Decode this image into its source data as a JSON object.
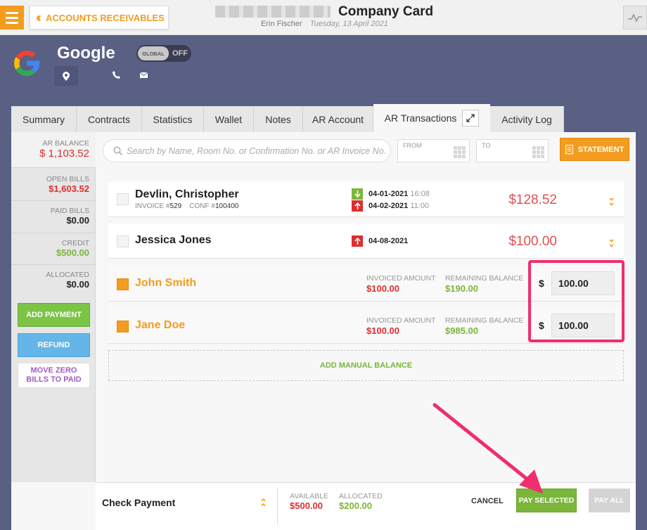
{
  "topbar": {
    "back_label": "ACCOUNTS RECEIVABLES",
    "title": "Company Card",
    "user": "Erin Fischer",
    "date": "Tuesday, 13 April 2021"
  },
  "company": {
    "name": "Google",
    "toggle_knob": "GLOBAL",
    "toggle_state": "OFF"
  },
  "tabs": [
    "Summary",
    "Contracts",
    "Statistics",
    "Wallet",
    "Notes",
    "AR Account",
    "AR Transactions",
    "Activity Log"
  ],
  "sidebar": {
    "ar_balance_label": "AR BALANCE",
    "ar_balance_value": "$ 1,103.52",
    "open_bills_label": "OPEN BILLS",
    "open_bills_value": "$1,603.52",
    "paid_bills_label": "PAID BILLS",
    "paid_bills_value": "$0.00",
    "credit_label": "CREDIT",
    "credit_value": "$500.00",
    "allocated_label": "ALLOCATED",
    "allocated_value": "$0.00",
    "add_payment": "ADD PAYMENT",
    "refund": "REFUND",
    "move_zero_line1": "MOVE ZERO",
    "move_zero_line2": "BILLS TO PAID"
  },
  "search": {
    "placeholder": "Search by Name, Room No. or Confirmation No. or AR Invoice No."
  },
  "date_filter": {
    "from": "FROM",
    "to": "TO"
  },
  "statement_label": "STATEMENT",
  "rows": [
    {
      "name": "Devlin, Christopher",
      "invoice_label": "INVOICE #",
      "invoice": "529",
      "conf_label": "CONF #",
      "conf": "100400",
      "arrival": "04-01-2021",
      "arrival_time": "16:08",
      "departure": "04-02-2021",
      "departure_time": "11:00",
      "amount": "$128.52"
    },
    {
      "name": "Jessica Jones",
      "departure": "04-08-2021",
      "amount": "$100.00"
    },
    {
      "name": "John Smith",
      "invoiced_label": "INVOICED AMOUNT",
      "invoiced": "$100.00",
      "remaining_label": "REMAINING BALANCE",
      "remaining": "$190.00",
      "currency": "$",
      "pay_value": "100.00"
    },
    {
      "name": "Jane Doe",
      "invoiced_label": "INVOICED AMOUNT",
      "invoiced": "$100.00",
      "remaining_label": "REMAINING BALANCE",
      "remaining": "$985.00",
      "currency": "$",
      "pay_value": "100.00"
    }
  ],
  "manual_balance": "ADD MANUAL BALANCE",
  "footer": {
    "method": "Check Payment",
    "available_label": "AVAILABLE",
    "available_value": "$500.00",
    "allocated_label": "ALLOCATED",
    "allocated_value": "$200.00",
    "cancel": "CANCEL",
    "pay_selected": "PAY SELECTED",
    "pay_all": "PAY ALL"
  },
  "colors": {
    "accent_orange": "#f39c1f",
    "green": "#7bb53a",
    "red": "#dc2f2f",
    "highlight_pink": "#ef2e6e",
    "background": "#5a6083"
  },
  "icons": [
    "menu-icon",
    "chevron-double-left-icon",
    "activity-chart-icon",
    "google-logo",
    "location-pin-icon",
    "phone-icon",
    "mail-icon",
    "expand-icon",
    "search-icon",
    "calendar-grid-icon",
    "receipt-icon",
    "arrow-down-icon",
    "arrow-up-icon",
    "chevron-double-down-icon",
    "chevron-double-up-icon"
  ]
}
